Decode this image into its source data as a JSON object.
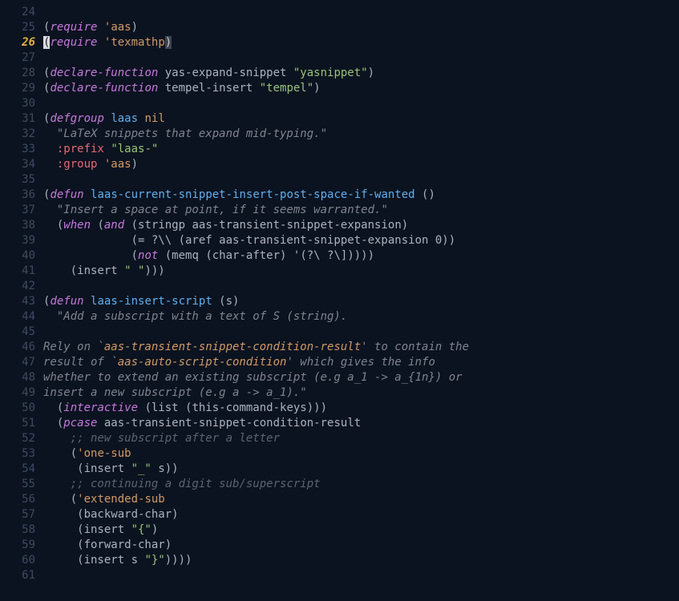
{
  "current_line": 26,
  "lines": [
    {
      "n": 24,
      "tokens": []
    },
    {
      "n": 25,
      "tokens": [
        {
          "t": "(",
          "c": "pn"
        },
        {
          "t": "require",
          "c": "kw"
        },
        {
          "t": " ",
          "c": "pn"
        },
        {
          "t": "'aas",
          "c": "sym"
        },
        {
          "t": ")",
          "c": "pn"
        }
      ]
    },
    {
      "n": 26,
      "current": true,
      "tokens": [
        {
          "t": "(",
          "c": "hlp"
        },
        {
          "t": "require",
          "c": "kw"
        },
        {
          "t": " ",
          "c": "pn"
        },
        {
          "t": "'texmathp",
          "c": "sym"
        },
        {
          "t": ")",
          "c": "cur"
        }
      ]
    },
    {
      "n": 27,
      "tokens": []
    },
    {
      "n": 28,
      "tokens": [
        {
          "t": "(",
          "c": "pn"
        },
        {
          "t": "declare-function",
          "c": "kw"
        },
        {
          "t": " yas-expand-snippet ",
          "c": "pn"
        },
        {
          "t": "\"yasnippet\"",
          "c": "str"
        },
        {
          "t": ")",
          "c": "pn"
        }
      ]
    },
    {
      "n": 29,
      "tokens": [
        {
          "t": "(",
          "c": "pn"
        },
        {
          "t": "declare-function",
          "c": "kw"
        },
        {
          "t": " tempel-insert ",
          "c": "pn"
        },
        {
          "t": "\"tempel\"",
          "c": "str"
        },
        {
          "t": ")",
          "c": "pn"
        }
      ]
    },
    {
      "n": 30,
      "tokens": []
    },
    {
      "n": 31,
      "tokens": [
        {
          "t": "(",
          "c": "pn"
        },
        {
          "t": "defgroup",
          "c": "kw"
        },
        {
          "t": " ",
          "c": "pn"
        },
        {
          "t": "laas",
          "c": "fn"
        },
        {
          "t": " ",
          "c": "pn"
        },
        {
          "t": "nil",
          "c": "sym"
        }
      ]
    },
    {
      "n": 32,
      "tokens": [
        {
          "t": "  ",
          "c": "pn"
        },
        {
          "t": "\"LaTeX snippets that expand mid-typing.\"",
          "c": "doc"
        }
      ]
    },
    {
      "n": 33,
      "tokens": [
        {
          "t": "  ",
          "c": "pn"
        },
        {
          "t": ":prefix",
          "c": "key"
        },
        {
          "t": " ",
          "c": "pn"
        },
        {
          "t": "\"laas-\"",
          "c": "str"
        }
      ]
    },
    {
      "n": 34,
      "tokens": [
        {
          "t": "  ",
          "c": "pn"
        },
        {
          "t": ":group",
          "c": "key"
        },
        {
          "t": " ",
          "c": "pn"
        },
        {
          "t": "'aas",
          "c": "sym"
        },
        {
          "t": ")",
          "c": "pn"
        }
      ]
    },
    {
      "n": 35,
      "tokens": []
    },
    {
      "n": 36,
      "tokens": [
        {
          "t": "(",
          "c": "pn"
        },
        {
          "t": "defun",
          "c": "kw"
        },
        {
          "t": " ",
          "c": "pn"
        },
        {
          "t": "laas-current-snippet-insert-post-space-if-wanted",
          "c": "fn"
        },
        {
          "t": " ()",
          "c": "pn"
        }
      ]
    },
    {
      "n": 37,
      "tokens": [
        {
          "t": "  ",
          "c": "pn"
        },
        {
          "t": "\"Insert a space at point, if it seems warranted.\"",
          "c": "doc"
        }
      ]
    },
    {
      "n": 38,
      "tokens": [
        {
          "t": "  (",
          "c": "pn"
        },
        {
          "t": "when",
          "c": "kw"
        },
        {
          "t": " (",
          "c": "pn"
        },
        {
          "t": "and",
          "c": "kw"
        },
        {
          "t": " (stringp aas-transient-snippet-expansion)",
          "c": "pn"
        }
      ]
    },
    {
      "n": 39,
      "tokens": [
        {
          "t": "             (= ?\\\\ (aref aas-transient-snippet-expansion 0))",
          "c": "pn"
        }
      ]
    },
    {
      "n": 40,
      "tokens": [
        {
          "t": "             (",
          "c": "pn"
        },
        {
          "t": "not",
          "c": "kw"
        },
        {
          "t": " (memq (char-after) '(?\\ ?\\]))))",
          "c": "pn"
        }
      ]
    },
    {
      "n": 41,
      "tokens": [
        {
          "t": "    (insert ",
          "c": "pn"
        },
        {
          "t": "\" \"",
          "c": "str"
        },
        {
          "t": ")))",
          "c": "pn"
        }
      ]
    },
    {
      "n": 42,
      "tokens": []
    },
    {
      "n": 43,
      "tokens": [
        {
          "t": "(",
          "c": "pn"
        },
        {
          "t": "defun",
          "c": "kw"
        },
        {
          "t": " ",
          "c": "pn"
        },
        {
          "t": "laas-insert-script",
          "c": "fn"
        },
        {
          "t": " (s)",
          "c": "pn"
        }
      ]
    },
    {
      "n": 44,
      "tokens": [
        {
          "t": "  ",
          "c": "pn"
        },
        {
          "t": "\"Add a subscript with a text of S (string).",
          "c": "doc"
        }
      ]
    },
    {
      "n": 45,
      "tokens": []
    },
    {
      "n": 46,
      "tokens": [
        {
          "t": "Rely on `",
          "c": "doc"
        },
        {
          "t": "aas-transient-snippet-condition-result",
          "c": "ref"
        },
        {
          "t": "' to contain the",
          "c": "doc"
        }
      ]
    },
    {
      "n": 47,
      "tokens": [
        {
          "t": "result of `",
          "c": "doc"
        },
        {
          "t": "aas-auto-script-condition",
          "c": "ref"
        },
        {
          "t": "' which gives the info",
          "c": "doc"
        }
      ]
    },
    {
      "n": 48,
      "tokens": [
        {
          "t": "whether to extend an existing subscript (e.g a_1 -> a_{1n}) or",
          "c": "doc"
        }
      ]
    },
    {
      "n": 49,
      "tokens": [
        {
          "t": "insert a new subscript (e.g a -> a_1).\"",
          "c": "doc"
        }
      ]
    },
    {
      "n": 50,
      "tokens": [
        {
          "t": "  (",
          "c": "pn"
        },
        {
          "t": "interactive",
          "c": "kw"
        },
        {
          "t": " (list (this-command-keys)))",
          "c": "pn"
        }
      ]
    },
    {
      "n": 51,
      "tokens": [
        {
          "t": "  (",
          "c": "pn"
        },
        {
          "t": "pcase",
          "c": "kw"
        },
        {
          "t": " aas-transient-snippet-condition-result",
          "c": "pn"
        }
      ]
    },
    {
      "n": 52,
      "tokens": [
        {
          "t": "    ",
          "c": "pn"
        },
        {
          "t": ";; new subscript after a letter",
          "c": "cmt"
        }
      ]
    },
    {
      "n": 53,
      "tokens": [
        {
          "t": "    (",
          "c": "pn"
        },
        {
          "t": "'one-sub",
          "c": "sym"
        }
      ]
    },
    {
      "n": 54,
      "tokens": [
        {
          "t": "     (insert ",
          "c": "pn"
        },
        {
          "t": "\"_\"",
          "c": "str"
        },
        {
          "t": " s))",
          "c": "pn"
        }
      ]
    },
    {
      "n": 55,
      "tokens": [
        {
          "t": "    ",
          "c": "pn"
        },
        {
          "t": ";; continuing a digit sub/superscript",
          "c": "cmt"
        }
      ]
    },
    {
      "n": 56,
      "tokens": [
        {
          "t": "    (",
          "c": "pn"
        },
        {
          "t": "'extended-sub",
          "c": "sym"
        }
      ]
    },
    {
      "n": 57,
      "tokens": [
        {
          "t": "     (backward-char)",
          "c": "pn"
        }
      ]
    },
    {
      "n": 58,
      "tokens": [
        {
          "t": "     (insert ",
          "c": "pn"
        },
        {
          "t": "\"{\"",
          "c": "str"
        },
        {
          "t": ")",
          "c": "pn"
        }
      ]
    },
    {
      "n": 59,
      "tokens": [
        {
          "t": "     (forward-char)",
          "c": "pn"
        }
      ]
    },
    {
      "n": 60,
      "tokens": [
        {
          "t": "     (insert s ",
          "c": "pn"
        },
        {
          "t": "\"}\"",
          "c": "str"
        },
        {
          "t": "))))",
          "c": "pn"
        }
      ]
    },
    {
      "n": 61,
      "tokens": []
    }
  ]
}
